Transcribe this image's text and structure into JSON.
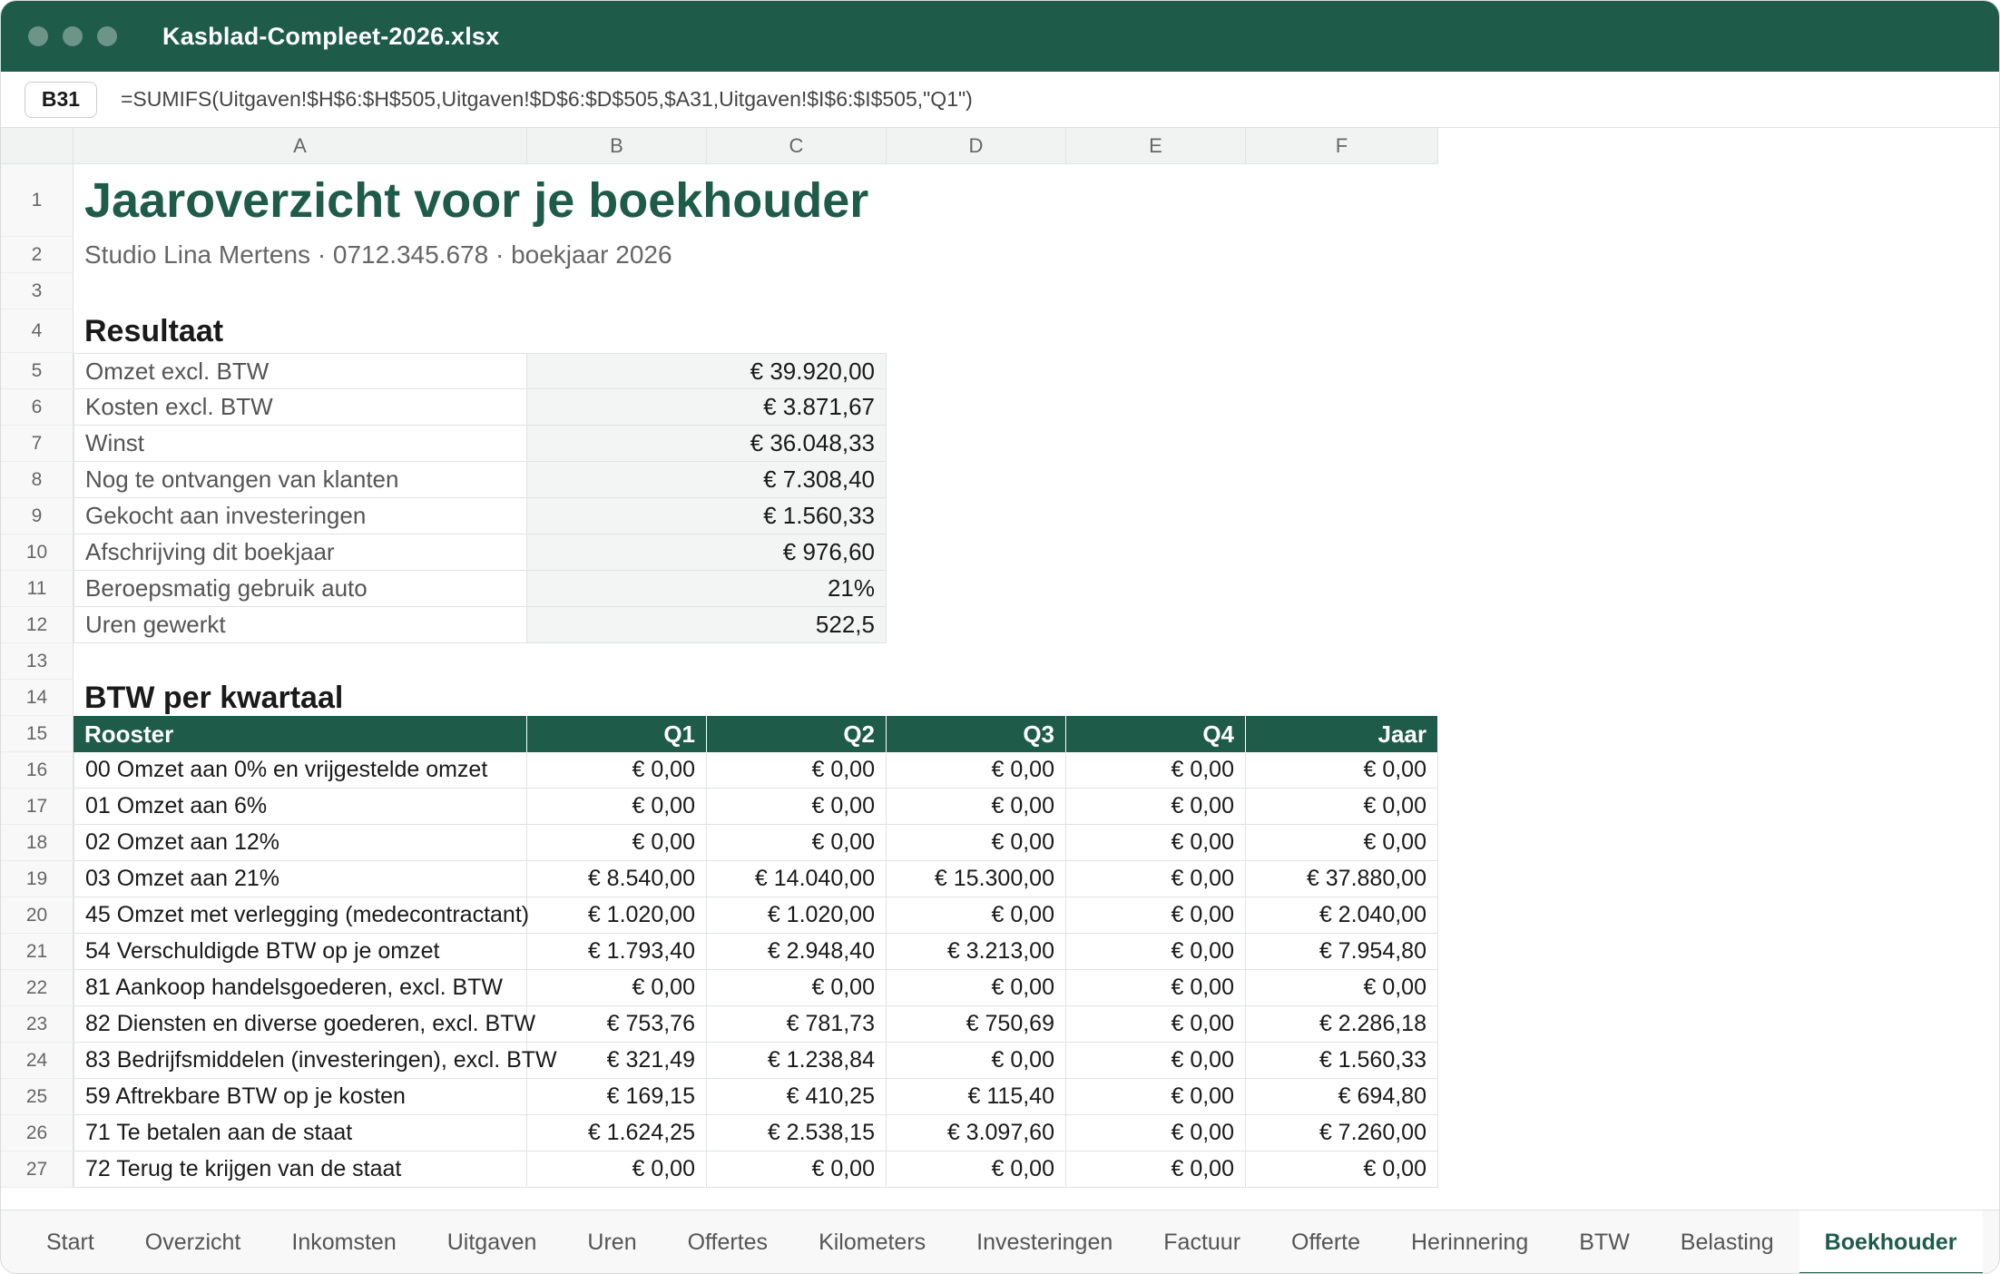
{
  "window": {
    "title": "Kasblad-Compleet-2026.xlsx"
  },
  "formula_bar": {
    "cell_ref": "B31",
    "formula": "=SUMIFS(Uitgaven!$H$6:$H$505,Uitgaven!$D$6:$D$505,$A31,Uitgaven!$I$6:$I$505,\"Q1\")"
  },
  "columns": [
    "A",
    "B",
    "C",
    "D",
    "E",
    "F"
  ],
  "rows": [
    "1",
    "2",
    "3",
    "4",
    "5",
    "6",
    "7",
    "8",
    "9",
    "10",
    "11",
    "12",
    "13",
    "14",
    "15",
    "16",
    "17",
    "18",
    "19",
    "20",
    "21",
    "22",
    "23",
    "24",
    "25",
    "26",
    "27"
  ],
  "sheet": {
    "title": "Jaaroverzicht voor je boekhouder",
    "subtitle": "Studio Lina Mertens · 0712.345.678 · boekjaar 2026",
    "resultaat_heading": "Resultaat",
    "resultaat": [
      {
        "label": "Omzet excl. BTW",
        "value": "€ 39.920,00"
      },
      {
        "label": "Kosten excl. BTW",
        "value": "€ 3.871,67"
      },
      {
        "label": "Winst",
        "value": "€ 36.048,33"
      },
      {
        "label": "Nog te ontvangen van klanten",
        "value": "€ 7.308,40"
      },
      {
        "label": "Gekocht aan investeringen",
        "value": "€ 1.560,33"
      },
      {
        "label": "Afschrijving dit boekjaar",
        "value": "€ 976,60"
      },
      {
        "label": "Beroepsmatig gebruik auto",
        "value": "21%"
      },
      {
        "label": "Uren gewerkt",
        "value": "522,5"
      }
    ],
    "btw_heading": "BTW per kwartaal",
    "btw_headers": [
      "Rooster",
      "Q1",
      "Q2",
      "Q3",
      "Q4",
      "Jaar"
    ],
    "btw_rows": [
      [
        "00 Omzet aan 0% en vrijgestelde omzet",
        "€ 0,00",
        "€ 0,00",
        "€ 0,00",
        "€ 0,00",
        "€ 0,00"
      ],
      [
        "01 Omzet aan 6%",
        "€ 0,00",
        "€ 0,00",
        "€ 0,00",
        "€ 0,00",
        "€ 0,00"
      ],
      [
        "02 Omzet aan 12%",
        "€ 0,00",
        "€ 0,00",
        "€ 0,00",
        "€ 0,00",
        "€ 0,00"
      ],
      [
        "03 Omzet aan 21%",
        "€ 8.540,00",
        "€ 14.040,00",
        "€ 15.300,00",
        "€ 0,00",
        "€ 37.880,00"
      ],
      [
        "45 Omzet met verlegging (medecontractant)",
        "€ 1.020,00",
        "€ 1.020,00",
        "€ 0,00",
        "€ 0,00",
        "€ 2.040,00"
      ],
      [
        "54 Verschuldigde BTW op je omzet",
        "€ 1.793,40",
        "€ 2.948,40",
        "€ 3.213,00",
        "€ 0,00",
        "€ 7.954,80"
      ],
      [
        "81 Aankoop handelsgoederen, excl. BTW",
        "€ 0,00",
        "€ 0,00",
        "€ 0,00",
        "€ 0,00",
        "€ 0,00"
      ],
      [
        "82 Diensten en diverse goederen, excl. BTW",
        "€ 753,76",
        "€ 781,73",
        "€ 750,69",
        "€ 0,00",
        "€ 2.286,18"
      ],
      [
        "83 Bedrijfsmiddelen (investeringen), excl. BTW",
        "€ 321,49",
        "€ 1.238,84",
        "€ 0,00",
        "€ 0,00",
        "€ 1.560,33"
      ],
      [
        "59 Aftrekbare BTW op je kosten",
        "€ 169,15",
        "€ 410,25",
        "€ 115,40",
        "€ 0,00",
        "€ 694,80"
      ],
      [
        "71 Te betalen aan de staat",
        "€ 1.624,25",
        "€ 2.538,15",
        "€ 3.097,60",
        "€ 0,00",
        "€ 7.260,00"
      ],
      [
        "72 Terug te krijgen van de staat",
        "€ 0,00",
        "€ 0,00",
        "€ 0,00",
        "€ 0,00",
        "€ 0,00"
      ]
    ]
  },
  "tabs": [
    {
      "label": "Start",
      "active": false
    },
    {
      "label": "Overzicht",
      "active": false
    },
    {
      "label": "Inkomsten",
      "active": false
    },
    {
      "label": "Uitgaven",
      "active": false
    },
    {
      "label": "Uren",
      "active": false
    },
    {
      "label": "Offertes",
      "active": false
    },
    {
      "label": "Kilometers",
      "active": false
    },
    {
      "label": "Investeringen",
      "active": false
    },
    {
      "label": "Factuur",
      "active": false
    },
    {
      "label": "Offerte",
      "active": false
    },
    {
      "label": "Herinnering",
      "active": false
    },
    {
      "label": "BTW",
      "active": false
    },
    {
      "label": "Belasting",
      "active": false
    },
    {
      "label": "Boekhouder",
      "active": true
    }
  ],
  "colors": {
    "brand": "#1e5b48",
    "value_bg": "#f3f5f4"
  }
}
